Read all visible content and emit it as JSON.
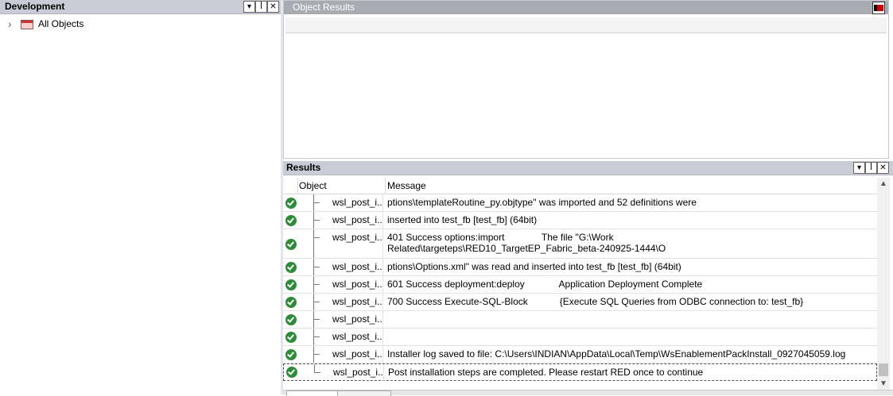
{
  "dev_panel": {
    "title": "Development",
    "buttons": [
      "▾",
      "ꟾ",
      "✕"
    ],
    "tree": {
      "label": "All Objects",
      "expander": "›"
    }
  },
  "object_results": {
    "title": "Object Results"
  },
  "results": {
    "title": "Results",
    "buttons": [
      "▾",
      "ꟾ",
      "✕"
    ],
    "columns": {
      "object": "Object",
      "message": "Message"
    },
    "rows": [
      {
        "object": "wsl_post_i...",
        "message": "ptions\\templateRoutine_py.objtype\" was imported and 52 definitions were"
      },
      {
        "object": "wsl_post_i...",
        "message": "inserted into test_fb [test_fb] (64bit)"
      },
      {
        "object": "wsl_post_i...",
        "message": "401 Success options:import              The file \"G:\\Work\nRelated\\targeteps\\RED10_TargetEP_Fabric_beta-240925-1444\\O"
      },
      {
        "object": "wsl_post_i...",
        "message": "ptions\\Options.xml\" was read and inserted into test_fb [test_fb] (64bit)"
      },
      {
        "object": "wsl_post_i...",
        "message": "601 Success deployment:deploy             Application Deployment Complete"
      },
      {
        "object": "wsl_post_i...",
        "message": "700 Success Execute-SQL-Block            {Execute SQL Queries from ODBC connection to: test_fb}"
      },
      {
        "object": "wsl_post_i...",
        "message": ""
      },
      {
        "object": "wsl_post_i...",
        "message": ""
      },
      {
        "object": "wsl_post_i...",
        "message": "Installer log saved to file: C:\\Users\\INDIAN\\AppData\\Local\\Temp\\WsEnablementPackInstall_0927045059.log"
      },
      {
        "object": "wsl_post_i...",
        "message": "Post installation steps are completed. Please restart RED once to continue"
      }
    ],
    "scroll": {
      "up": "▲",
      "down": "▼"
    }
  },
  "colors": {
    "success": "#2e8b3a",
    "header_bg": "#c9ccd4",
    "obj_header_bg": "#a8abb2"
  }
}
